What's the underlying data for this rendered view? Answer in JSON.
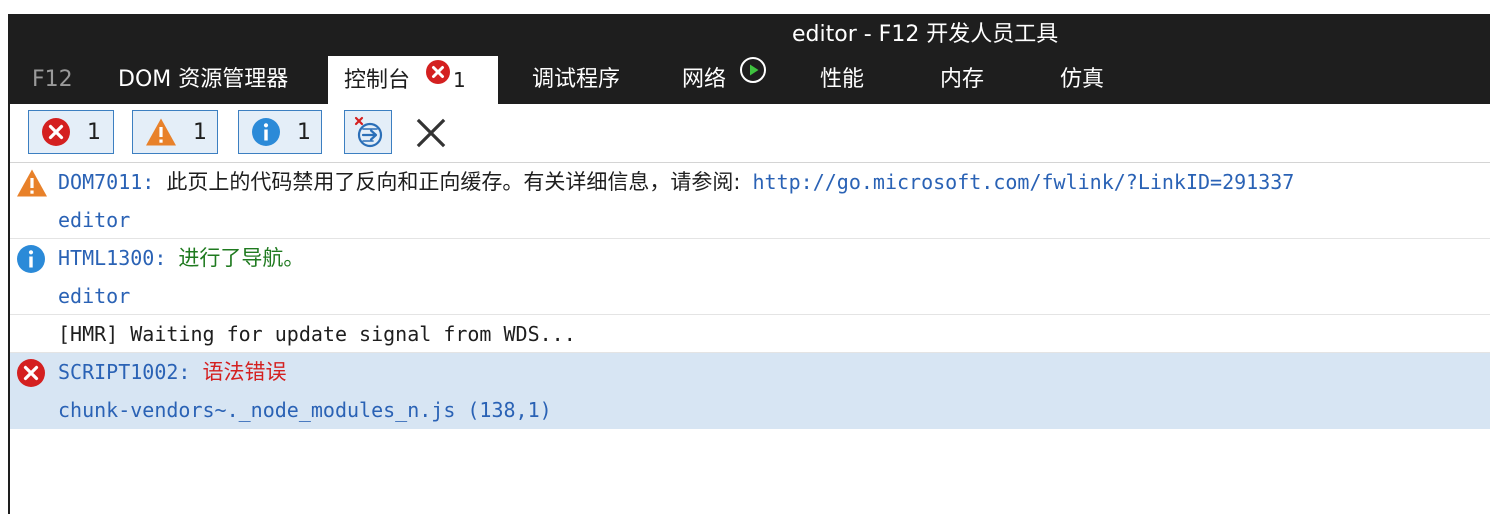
{
  "window": {
    "title": "editor - F12 开发人员工具"
  },
  "tabs": [
    {
      "label": "F12"
    },
    {
      "label": "DOM 资源管理器"
    },
    {
      "label": "控制台",
      "badge_count": "1"
    },
    {
      "label": "调试程序"
    },
    {
      "label": "网络"
    },
    {
      "label": "性能"
    },
    {
      "label": "内存"
    },
    {
      "label": "仿真"
    }
  ],
  "toolbar": {
    "errors_count": "1",
    "warnings_count": "1",
    "info_count": "1"
  },
  "console": {
    "entries": [
      {
        "level": "warning",
        "code": "DOM7011:",
        "message": "此页上的代码禁用了反向和正向缓存。有关详细信息，请参阅:",
        "link": "http://go.microsoft.com/fwlink/?LinkID=291337",
        "source": "editor"
      },
      {
        "level": "info",
        "code": "HTML1300:",
        "message": "进行了导航。",
        "source": "editor"
      },
      {
        "level": "log",
        "message": "[HMR] Waiting for update signal from WDS..."
      },
      {
        "level": "error",
        "code": "SCRIPT1002:",
        "message": "语法错误",
        "source": "chunk-vendors~._node_modules_n.js (138,1)"
      }
    ]
  },
  "colors": {
    "titlebar_bg": "#1e1e1e",
    "accent_blue": "#3c7fc1",
    "error_red": "#d42020",
    "warning_orange": "#e8812a",
    "info_blue": "#2b8ad8",
    "selected_row": "#d7e5f3"
  },
  "icons": {
    "error": "error-icon",
    "warning": "warning-icon",
    "info": "info-icon",
    "play": "play-icon",
    "clear_on_navigate": "clear-on-navigate-icon",
    "clear": "clear-console-icon"
  }
}
